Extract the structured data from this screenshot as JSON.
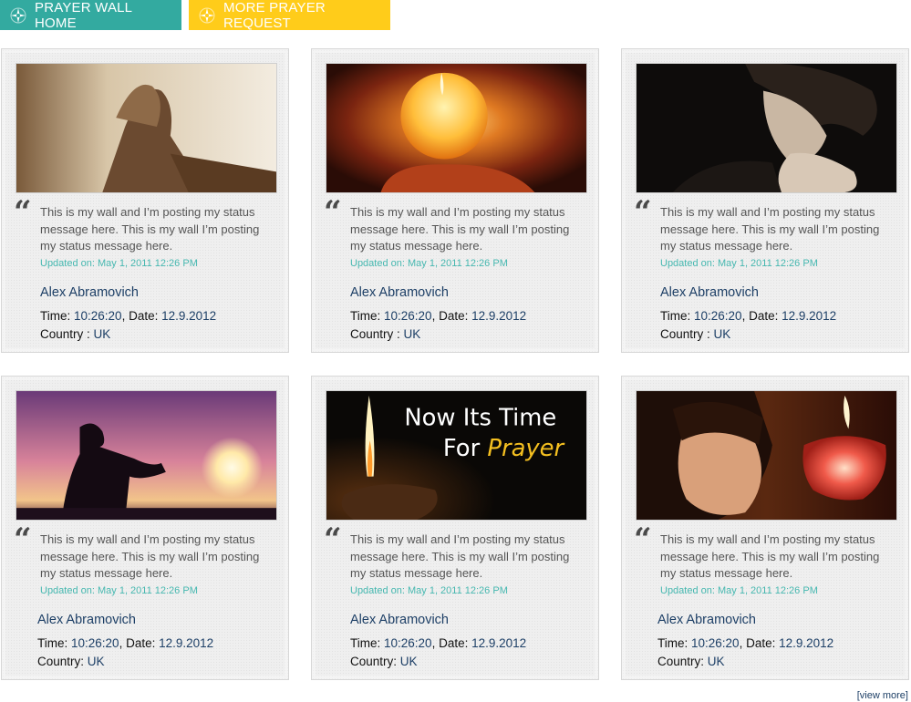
{
  "nav": {
    "home_label": "PRAYER WALL HOME",
    "more_label": "MORE PRAYER REQUEST"
  },
  "cards": [
    {
      "image": "praying-hands-photo",
      "message": "This is my wall and I’m posting my status message here. This is my wall I’m posting my status message here.",
      "updated": "Updated on: May 1, 2011 12:26 PM",
      "name": "Alex Abramovich",
      "time_label": "Time: ",
      "time": "10:26:20",
      "date_label": ", Date: ",
      "date": "12.9.2012",
      "country_label": "Country : ",
      "country": "UK"
    },
    {
      "image": "candle-in-hands-photo",
      "message": "This is my wall and I’m posting my status message here. This is my wall I’m posting my status message here.",
      "updated": "Updated on: May 1, 2011 12:26 PM",
      "name": "Alex Abramovich",
      "time_label": "Time: ",
      "time": "10:26:20",
      "date_label": ", Date: ",
      "date": "12.9.2012",
      "country_label": "Country : ",
      "country": "UK"
    },
    {
      "image": "man-praying-photo",
      "message": "This is my wall and I’m posting my status message here. This is my wall I’m posting my status message here.",
      "updated": "Updated on: May 1, 2011 12:26 PM",
      "name": "Alex Abramovich",
      "time_label": "Time: ",
      "time": "10:26:20",
      "date_label": ", Date: ",
      "date": "12.9.2012",
      "country_label": "Country : ",
      "country": "UK"
    },
    {
      "image": "sunset-silhouette-photo",
      "message": "This is my wall and I’m posting my status message here. This is my wall I’m posting my status message here.",
      "updated": "Updated on: May 1, 2011 12:26 PM",
      "name": "Alex Abramovich",
      "time_label": "Time: ",
      "time": "10:26:20",
      "date_label": ", Date: ",
      "date": "12.9.2012",
      "country_label": "Country: ",
      "country": "UK"
    },
    {
      "image": "oil-lamp-photo",
      "image_caption_line1": "Now Its Time",
      "image_caption_for": "For ",
      "image_caption_prayer": "Prayer",
      "message": "This is my wall and I’m posting my status message here. This is my wall I’m posting my status message here.",
      "updated": "Updated on: May 1, 2011 12:26 PM",
      "name": "Alex Abramovich",
      "time_label": "Time: ",
      "time": "10:26:20",
      "date_label": ", Date: ",
      "date": "12.9.2012",
      "country_label": "Country: ",
      "country": "UK"
    },
    {
      "image": "child-with-candle-photo",
      "message": "This is my wall and I’m posting my status message here. This is my wall I’m posting my status message here.",
      "updated": "Updated on: May 1, 2011 12:26 PM",
      "name": "Alex Abramovich",
      "time_label": "Time: ",
      "time": "10:26:20",
      "date_label": ", Date: ",
      "date": "12.9.2012",
      "country_label": "Country: ",
      "country": "UK"
    }
  ],
  "view_more": "[view more]",
  "colors": {
    "teal": "#33aaa0",
    "yellow": "#ffcc1a",
    "navy": "#1d3f66",
    "updated": "#46b8b0"
  }
}
